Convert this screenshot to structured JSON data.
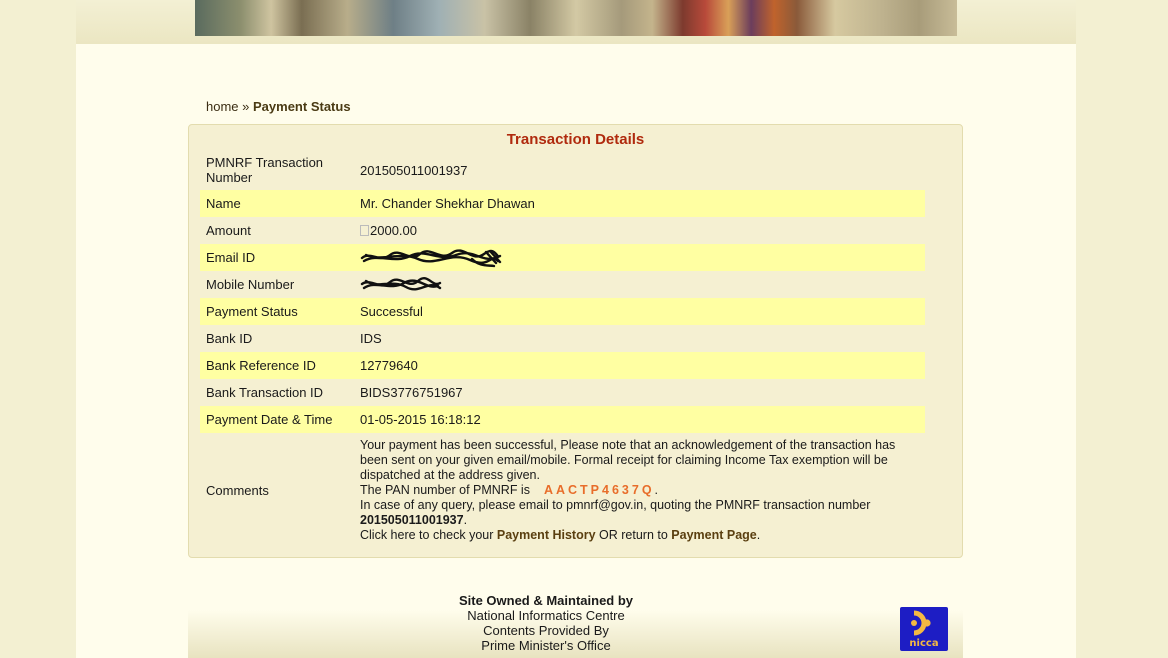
{
  "breadcrumb": {
    "home": "home",
    "separator": "»",
    "current": "Payment Status"
  },
  "transaction": {
    "title": "Transaction Details",
    "rows": [
      {
        "label": "PMNRF Transaction Number",
        "value": "201505011001937"
      },
      {
        "label": "Name",
        "value": "Mr. Chander Shekhar Dhawan"
      },
      {
        "label": "Amount",
        "value": "2000.00"
      },
      {
        "label": "Email ID",
        "value": ""
      },
      {
        "label": "Mobile Number",
        "value": ""
      },
      {
        "label": "Payment Status",
        "value": "Successful"
      },
      {
        "label": "Bank ID",
        "value": "IDS"
      },
      {
        "label": "Bank Reference ID",
        "value": "12779640"
      },
      {
        "label": "Bank Transaction ID",
        "value": "BIDS3776751967"
      },
      {
        "label": "Payment Date & Time",
        "value": "01-05-2015 16:18:12"
      }
    ],
    "comments": {
      "label": "Comments",
      "line1": "Your payment has been successful, Please note that an acknowledgement of the transaction has been sent on your given email/mobile. Formal receipt for claiming Income Tax exemption will be dispatched at the address given.",
      "pan_prefix": "The PAN number of PMNRF is",
      "pan": "AACTP4637Q",
      "query_text": "In case of any query, please email to pmnrf@gov.in, quoting the PMNRF transaction number",
      "txn_number": "201505011001937",
      "click_prefix": "Click here to check your",
      "payment_history": "Payment History",
      "or_text": "OR return to",
      "payment_page": "Payment Page"
    }
  },
  "footer": {
    "owned": "Site Owned & Maintained by",
    "nic": "National Informatics Centre",
    "contents": "Contents Provided By",
    "pmo": "Prime Minister's Office"
  },
  "logo": {
    "label": "nicca"
  },
  "colors": {
    "title_red": "#b02a0e",
    "highlight_row": "#ffffa2",
    "pan_orange": "#e86d2a",
    "logo_blue": "#1d1dc4"
  }
}
